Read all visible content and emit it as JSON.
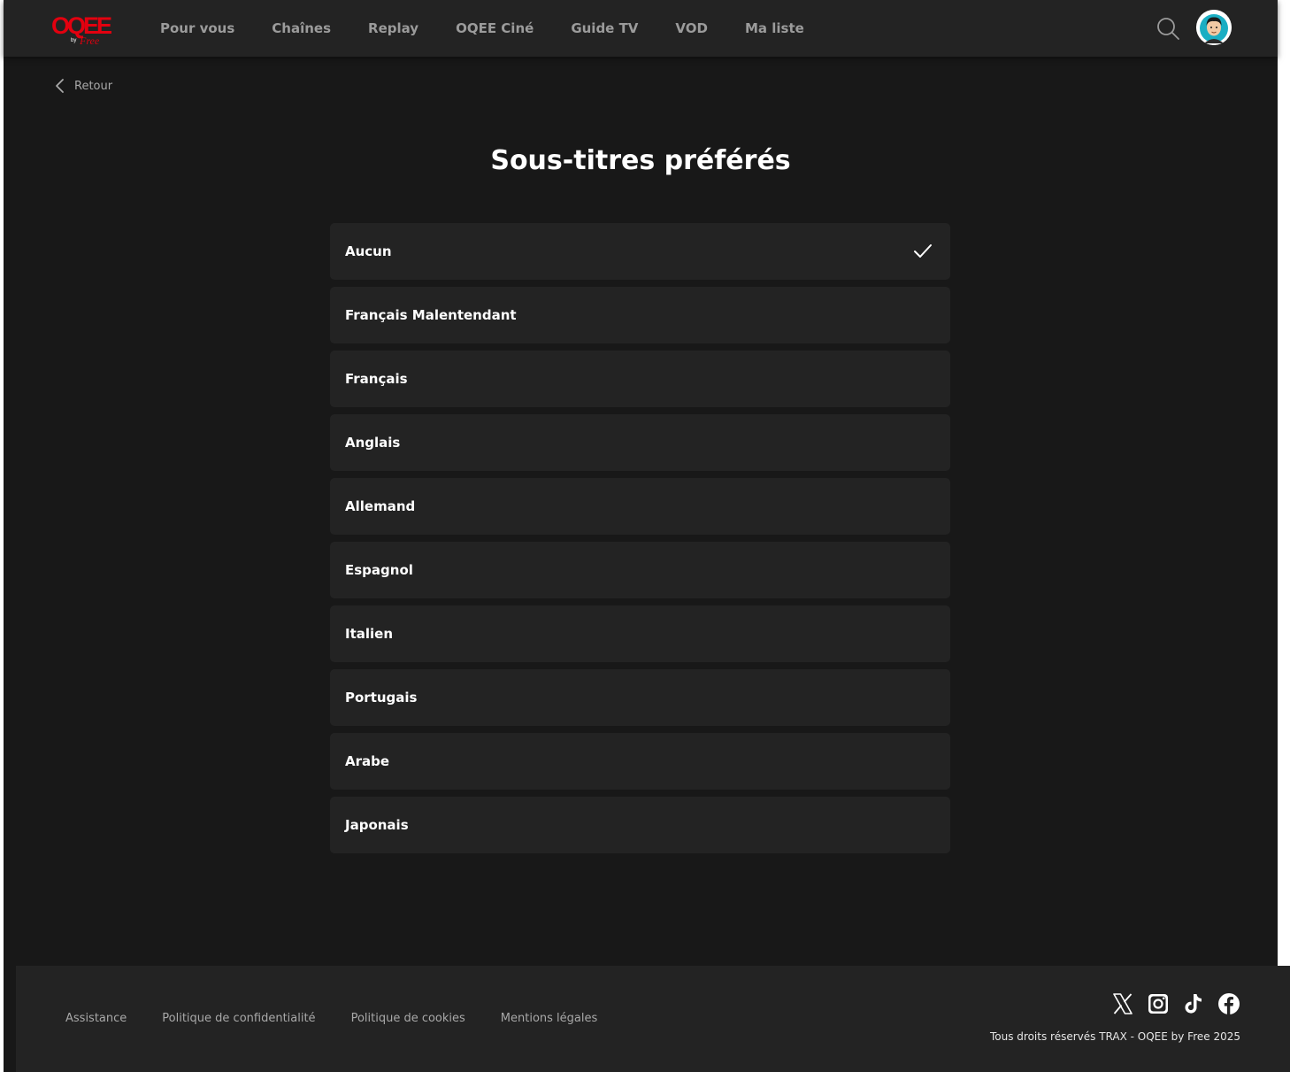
{
  "header": {
    "logo": {
      "text": "OQEE",
      "sub_by": "by",
      "sub_brand": "Free",
      "color": "#e3000f"
    },
    "nav": [
      {
        "label": "Pour vous"
      },
      {
        "label": "Chaînes"
      },
      {
        "label": "Replay"
      },
      {
        "label": "OQEE Ciné"
      },
      {
        "label": "Guide TV"
      },
      {
        "label": "VOD"
      },
      {
        "label": "Ma liste"
      }
    ],
    "search_icon": "search-icon",
    "avatar_icon": "avatar-icon"
  },
  "back": {
    "label": "Retour"
  },
  "page": {
    "title": "Sous-titres préférés"
  },
  "subtitle_options": [
    {
      "label": "Aucun",
      "selected": true
    },
    {
      "label": "Français Malentendant",
      "selected": false
    },
    {
      "label": "Français",
      "selected": false
    },
    {
      "label": "Anglais",
      "selected": false
    },
    {
      "label": "Allemand",
      "selected": false
    },
    {
      "label": "Espagnol",
      "selected": false
    },
    {
      "label": "Italien",
      "selected": false
    },
    {
      "label": "Portugais",
      "selected": false
    },
    {
      "label": "Arabe",
      "selected": false
    },
    {
      "label": "Japonais",
      "selected": false
    }
  ],
  "footer": {
    "links": [
      {
        "label": "Assistance"
      },
      {
        "label": "Politique de confidentialité"
      },
      {
        "label": "Politique de cookies"
      },
      {
        "label": "Mentions légales"
      }
    ],
    "socials": [
      "x-icon",
      "instagram-icon",
      "tiktok-icon",
      "facebook-icon"
    ],
    "copyright": "Tous droits réservés TRAX - OQEE by Free 2025"
  },
  "colors": {
    "background": "#181818",
    "surface": "#232323",
    "brand": "#e3000f"
  }
}
